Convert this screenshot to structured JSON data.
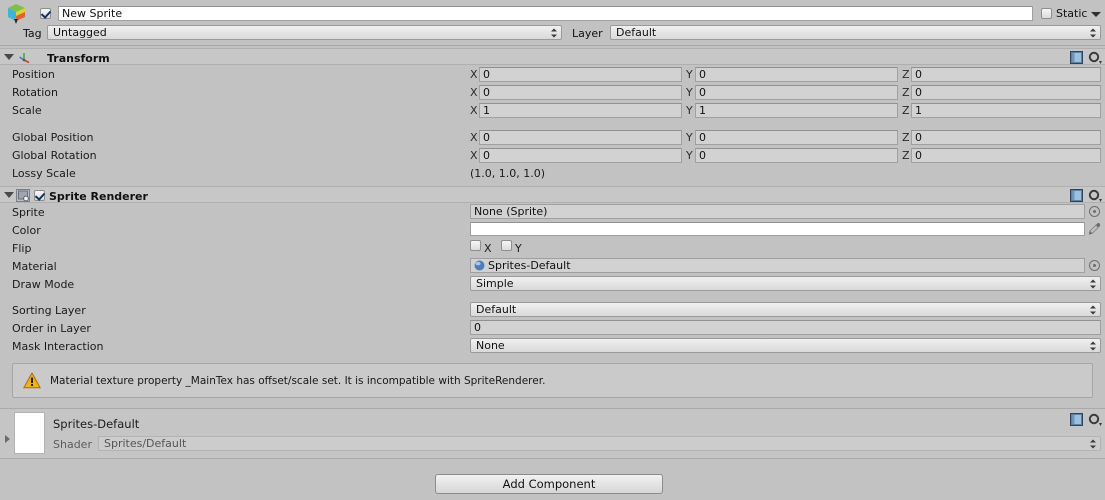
{
  "window": {
    "app": "Unity Inspector",
    "gameobject": {
      "name_value": "New Sprite",
      "enabled": true,
      "static_label": "Static",
      "static_checked": false,
      "tag_label": "Tag",
      "tag_value": "Untagged",
      "layer_label": "Layer",
      "layer_value": "Default"
    }
  },
  "transform": {
    "title": "Transform",
    "expanded": true,
    "axis": {
      "x": "X",
      "y": "Y",
      "z": "Z"
    },
    "rows": [
      {
        "label": "Position",
        "x": "0",
        "y": "0",
        "z": "0"
      },
      {
        "label": "Rotation",
        "x": "0",
        "y": "0",
        "z": "0"
      },
      {
        "label": "Scale",
        "x": "1",
        "y": "1",
        "z": "1"
      },
      {
        "label": "Global Position",
        "x": "0",
        "y": "0",
        "z": "0"
      },
      {
        "label": "Global Rotation",
        "x": "0",
        "y": "0",
        "z": "0"
      }
    ],
    "lossy_scale": {
      "label": "Lossy Scale",
      "value": "(1.0, 1.0, 1.0)"
    }
  },
  "sprite_renderer": {
    "title": "Sprite Renderer",
    "enabled": true,
    "expanded": true,
    "sprite": {
      "label": "Sprite",
      "value": "None (Sprite)"
    },
    "color": {
      "label": "Color",
      "value": "",
      "swatch": "#ffffff"
    },
    "flip": {
      "label": "Flip",
      "x_label": "X",
      "y_label": "Y",
      "x_checked": false,
      "y_checked": false
    },
    "material": {
      "label": "Material",
      "value": "Sprites-Default"
    },
    "draw_mode": {
      "label": "Draw Mode",
      "value": "Simple"
    },
    "sorting_layer": {
      "label": "Sorting Layer",
      "value": "Default"
    },
    "order_in_layer": {
      "label": "Order in Layer",
      "value": "0"
    },
    "mask_interaction": {
      "label": "Mask Interaction",
      "value": "None"
    },
    "warning": "Material texture property _MainTex has offset/scale set. It is incompatible with SpriteRenderer."
  },
  "material_asset": {
    "name": "Sprites-Default",
    "shader_label": "Shader",
    "shader_value": "Sprites/Default"
  },
  "footer": {
    "add_component_label": "Add Component"
  },
  "colors": {
    "background": "#c2c2c2",
    "header": "#c7c7c7",
    "field": "#d2d2d2",
    "warning_icon": "#f2b01e",
    "accent_blue": "#3b6ea5"
  }
}
